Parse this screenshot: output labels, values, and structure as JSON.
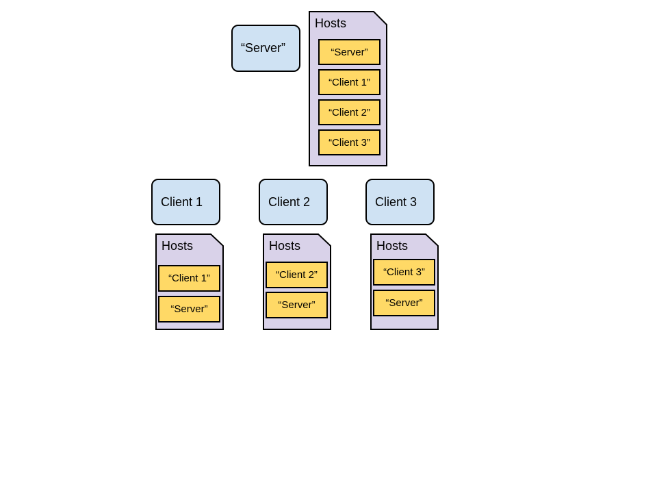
{
  "colors": {
    "node_fill": "#cfe2f3",
    "doc_fill": "#d9d2e9",
    "entry_fill": "#ffd966",
    "stroke": "#000000"
  },
  "server": {
    "label": "“Server”",
    "hosts": {
      "title": "Hosts",
      "entries": [
        "“Server”",
        "“Client 1”",
        "“Client 2”",
        "“Client 3”"
      ]
    }
  },
  "clients": [
    {
      "label": "Client 1",
      "hosts": {
        "title": "Hosts",
        "entries": [
          "“Client 1”",
          "“Server”"
        ]
      }
    },
    {
      "label": "Client 2",
      "hosts": {
        "title": "Hosts",
        "entries": [
          "“Client 2”",
          "“Server”"
        ]
      }
    },
    {
      "label": "Client 3",
      "hosts": {
        "title": "Hosts",
        "entries": [
          "“Client 3”",
          "“Server”"
        ]
      }
    }
  ]
}
